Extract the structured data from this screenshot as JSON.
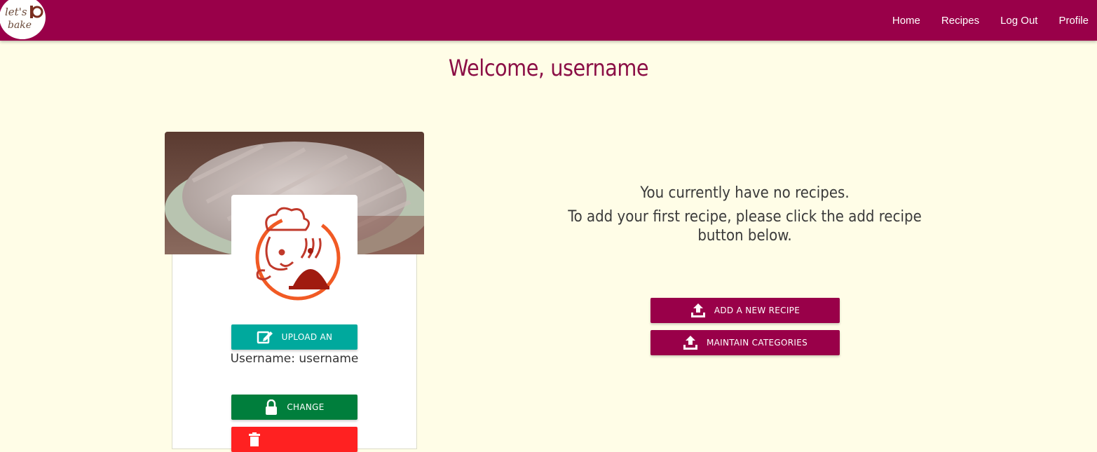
{
  "nav": {
    "brand": "let's bake",
    "links": [
      "Home",
      "Recipes",
      "Log Out",
      "Profile"
    ]
  },
  "welcome": "Welcome, username",
  "profile": {
    "upload_label": "UPLOAD AN",
    "username_text": "Username: username",
    "change_label": "CHANGE"
  },
  "main": {
    "no_recipes": "You currently have no recipes.",
    "instructions": "To add your first recipe, please click the add recipe button below.",
    "add_recipe_label": "ADD A NEW RECIPE",
    "maintain_categories_label": "MAINTAIN CATEGORIES"
  },
  "colors": {
    "brand": "#990049",
    "background": "#fffde7",
    "upload": "#00a99d",
    "change": "#007e3c",
    "delete": "#ff2121"
  }
}
